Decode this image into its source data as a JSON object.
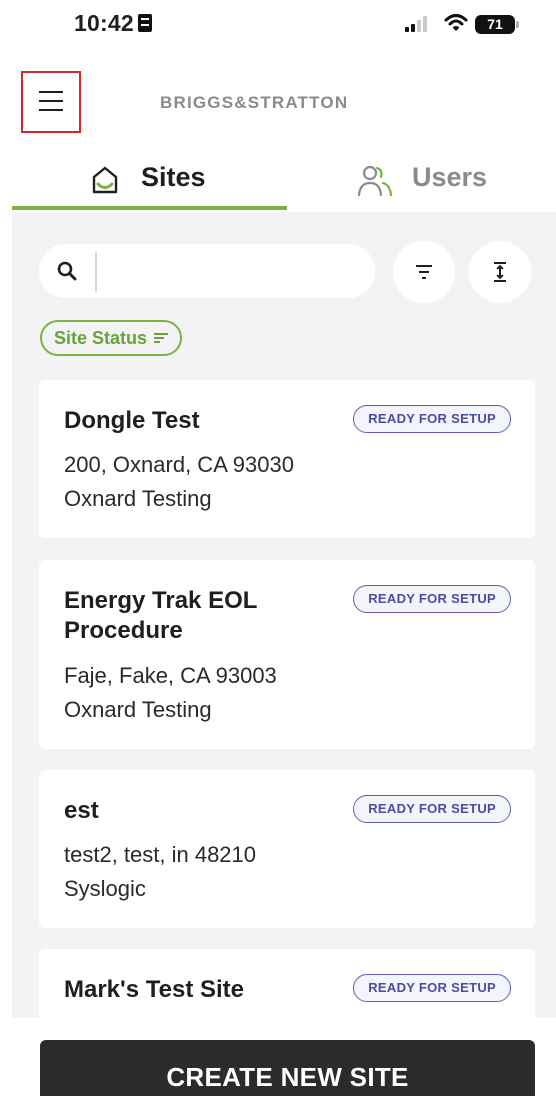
{
  "status_bar": {
    "time": "10:42",
    "battery": "71"
  },
  "header": {
    "brand": "BRIGGS&STRATTON"
  },
  "tabs": [
    {
      "label": "Sites",
      "active": true
    },
    {
      "label": "Users",
      "active": false
    }
  ],
  "search": {
    "value": "",
    "placeholder": ""
  },
  "filter_chip": {
    "label": "Site Status"
  },
  "sites": [
    {
      "name": "Dongle Test",
      "status": "READY FOR SETUP",
      "address": "200, Oxnard, CA 93030",
      "group": "Oxnard Testing"
    },
    {
      "name": "Energy Trak EOL Procedure",
      "status": "READY FOR SETUP",
      "address": "Faje, Fake, CA 93003",
      "group": "Oxnard Testing"
    },
    {
      "name": "est",
      "status": "READY FOR SETUP",
      "address": "test2, test, in 48210",
      "group": "Syslogic"
    },
    {
      "name": "Mark's Test Site",
      "status": "READY FOR SETUP",
      "address": "",
      "group": ""
    }
  ],
  "actions": {
    "create_label": "CREATE NEW SITE"
  },
  "colors": {
    "accent_green": "#7ab342",
    "badge_purple": "#5e5fb8",
    "highlight_red": "#d9252a",
    "button_dark": "#2b2b2b"
  }
}
